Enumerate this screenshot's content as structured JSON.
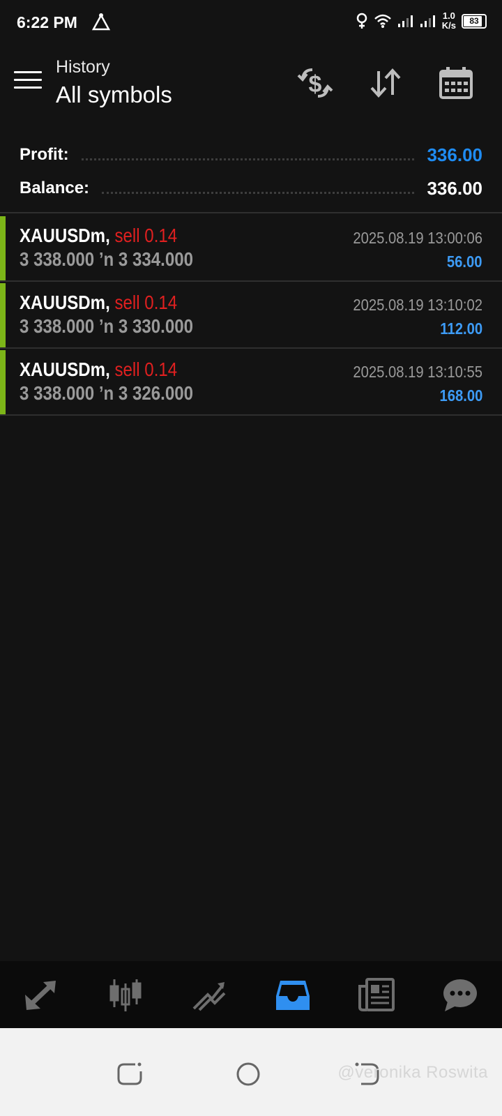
{
  "status_bar": {
    "time": "6:22 PM",
    "net_speed_value": "1.0",
    "net_speed_unit": "K/s",
    "battery": "83"
  },
  "header": {
    "subtitle": "History",
    "title": "All symbols",
    "icons": [
      "currency-exchange-icon",
      "sort-icon",
      "calendar-icon"
    ]
  },
  "summary": {
    "profit_label": "Profit:",
    "profit_value": "336.00",
    "balance_label": "Balance:",
    "balance_value": "336.00"
  },
  "deals": [
    {
      "symbol": "XAUUSDm,",
      "side": "sell 0.14",
      "prices": "3 338.000 ʼn  3 334.000",
      "time": "2025.08.19 13:00:06",
      "profit": "56.00"
    },
    {
      "symbol": "XAUUSDm,",
      "side": "sell 0.14",
      "prices": "3 338.000 ʼn  3 330.000",
      "time": "2025.08.19 13:10:02",
      "profit": "112.00"
    },
    {
      "symbol": "XAUUSDm,",
      "side": "sell 0.14",
      "prices": "3 338.000 ʼn  3 326.000",
      "time": "2025.08.19 13:10:55",
      "profit": "168.00"
    }
  ],
  "bottom_nav": {
    "items": [
      "quotes-icon",
      "chart-icon",
      "trade-icon",
      "history-icon",
      "news-icon",
      "chat-icon"
    ],
    "active": "history-icon"
  },
  "colors": {
    "accent": "#1f8cf2",
    "sell": "#e02020",
    "profit_bar": "#7cb518"
  },
  "watermark": "@veronika Roswita"
}
